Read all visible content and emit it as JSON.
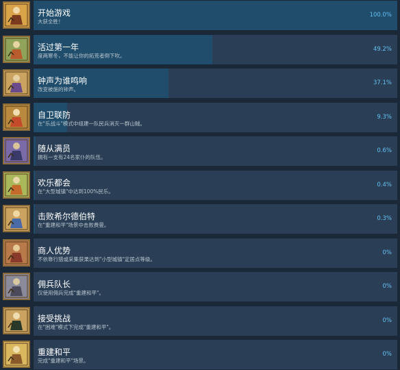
{
  "achievements": [
    {
      "title": "开始游戏",
      "desc": "大获全胜！",
      "percent": "100.0%",
      "progress": 1.0,
      "icon": "lute-icon"
    },
    {
      "title": "活过第一年",
      "desc": "度两寒冬，不能让你的拓荒者倒下吹。",
      "percent": "49.2%",
      "progress": 0.492,
      "icon": "farmer-icon"
    },
    {
      "title": "钟声为谁鸣响",
      "desc": "改变被施的钟声。",
      "percent": "37.1%",
      "progress": 0.371,
      "icon": "bell-ringer-icon"
    },
    {
      "title": "自卫联防",
      "desc": "在\"乐战斗\"模式中组建一队民兵消灭一群山贼。",
      "percent": "9.3%",
      "progress": 0.093,
      "icon": "militia-icon"
    },
    {
      "title": "随从满员",
      "desc": "拥有一支有24名家仆的队伍。",
      "percent": "0.6%",
      "progress": 0.006,
      "icon": "wizard-icon"
    },
    {
      "title": "欢乐都会",
      "desc": "在\"大型城镇\"中达到100%民乐。",
      "percent": "0.4%",
      "progress": 0.004,
      "icon": "festival-icon"
    },
    {
      "title": "击败希尔德伯特",
      "desc": "在\"重建和平\"场景中击败费曼。",
      "percent": "0.3%",
      "progress": 0.003,
      "icon": "knight-icon"
    },
    {
      "title": "商人优势",
      "desc": "不依靠行猎或采集获果达到\"小型城镇\"定居点等级。",
      "percent": "0%",
      "progress": 0,
      "icon": "merchant-icon"
    },
    {
      "title": "佣兵队长",
      "desc": "仅使用佣兵完成\"重建和平\"。",
      "percent": "0%",
      "progress": 0,
      "icon": "mercenary-icon"
    },
    {
      "title": "接受挑战",
      "desc": "在\"困难\"模式下完成\"重建和平\"。",
      "percent": "0%",
      "progress": 0,
      "icon": "challenge-icon"
    },
    {
      "title": "重建和平",
      "desc": "完成\"重建和平\"场景。",
      "percent": "0%",
      "progress": 0,
      "icon": "peace-icon"
    }
  ],
  "colors": {
    "bar": "#1f4d6b",
    "panel": "#2a3f55",
    "percent": "#66c0f4"
  }
}
